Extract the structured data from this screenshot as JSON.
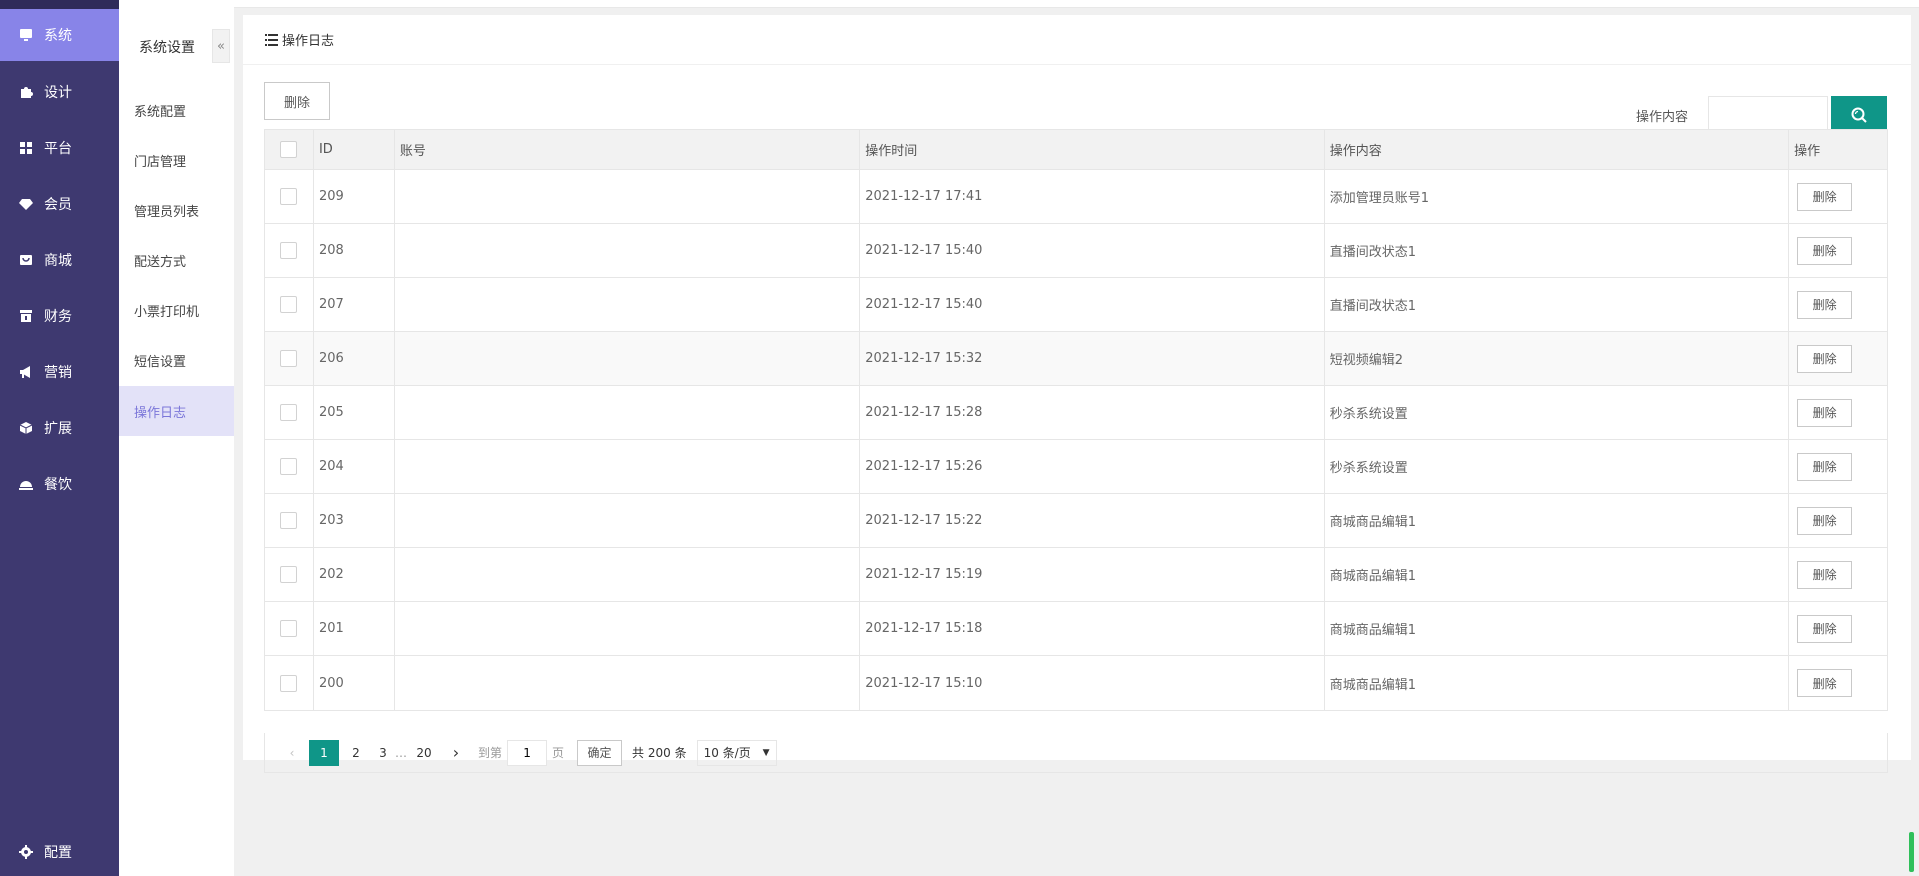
{
  "nav": {
    "items": [
      {
        "label": "系统",
        "icon": "system-icon",
        "active": true
      },
      {
        "label": "设计",
        "icon": "puzzle-icon"
      },
      {
        "label": "平台",
        "icon": "grid-icon"
      },
      {
        "label": "会员",
        "icon": "diamond-icon"
      },
      {
        "label": "商城",
        "icon": "shop-icon"
      },
      {
        "label": "财务",
        "icon": "finance-icon"
      },
      {
        "label": "营销",
        "icon": "megaphone-icon"
      },
      {
        "label": "扩展",
        "icon": "cube-icon"
      },
      {
        "label": "餐饮",
        "icon": "dish-icon"
      }
    ],
    "settings": {
      "label": "配置",
      "icon": "gear-icon"
    }
  },
  "subnav": {
    "title": "系统设置",
    "collapse_glyph": "«",
    "items": [
      "系统配置",
      "门店管理",
      "管理员列表",
      "配送方式",
      "小票打印机",
      "短信设置",
      "操作日志"
    ],
    "active_index": 6
  },
  "panel": {
    "title": "操作日志",
    "delete_label": "删除",
    "search_label": "操作内容",
    "search_value": ""
  },
  "table": {
    "headers": {
      "id": "ID",
      "account": "账号",
      "time": "操作时间",
      "content": "操作内容",
      "op": "操作"
    },
    "rows": [
      {
        "id": "209",
        "account": "",
        "time": "2021-12-17 17:41",
        "content": "添加管理员账号1",
        "op": "删除"
      },
      {
        "id": "208",
        "account": "",
        "time": "2021-12-17 15:40",
        "content": "直播间改状态1",
        "op": "删除"
      },
      {
        "id": "207",
        "account": "",
        "time": "2021-12-17 15:40",
        "content": "直播间改状态1",
        "op": "删除"
      },
      {
        "id": "206",
        "account": "",
        "time": "2021-12-17 15:32",
        "content": "短视频编辑2",
        "op": "删除"
      },
      {
        "id": "205",
        "account": "",
        "time": "2021-12-17 15:28",
        "content": "秒杀系统设置",
        "op": "删除"
      },
      {
        "id": "204",
        "account": "",
        "time": "2021-12-17 15:26",
        "content": "秒杀系统设置",
        "op": "删除"
      },
      {
        "id": "203",
        "account": "",
        "time": "2021-12-17 15:22",
        "content": "商城商品编辑1",
        "op": "删除"
      },
      {
        "id": "202",
        "account": "",
        "time": "2021-12-17 15:19",
        "content": "商城商品编辑1",
        "op": "删除"
      },
      {
        "id": "201",
        "account": "",
        "time": "2021-12-17 15:18",
        "content": "商城商品编辑1",
        "op": "删除"
      },
      {
        "id": "200",
        "account": "",
        "time": "2021-12-17 15:10",
        "content": "商城商品编辑1",
        "op": "删除"
      }
    ]
  },
  "pager": {
    "prev": "‹",
    "pages": [
      "1",
      "2",
      "3",
      "…",
      "20"
    ],
    "current": "1",
    "next": "›",
    "goto_prefix": "到第",
    "goto_value": "1",
    "goto_suffix": "页",
    "confirm": "确定",
    "total": "共 200 条",
    "page_size": "10 条/页",
    "page_size_arrow": "▼"
  },
  "colors": {
    "nav_bg": "#3e3970",
    "nav_active": "#8884e8",
    "subnav_active_bg": "#e3e2f8",
    "subnav_active_text": "#7b76d9",
    "primary": "#0f9688"
  }
}
